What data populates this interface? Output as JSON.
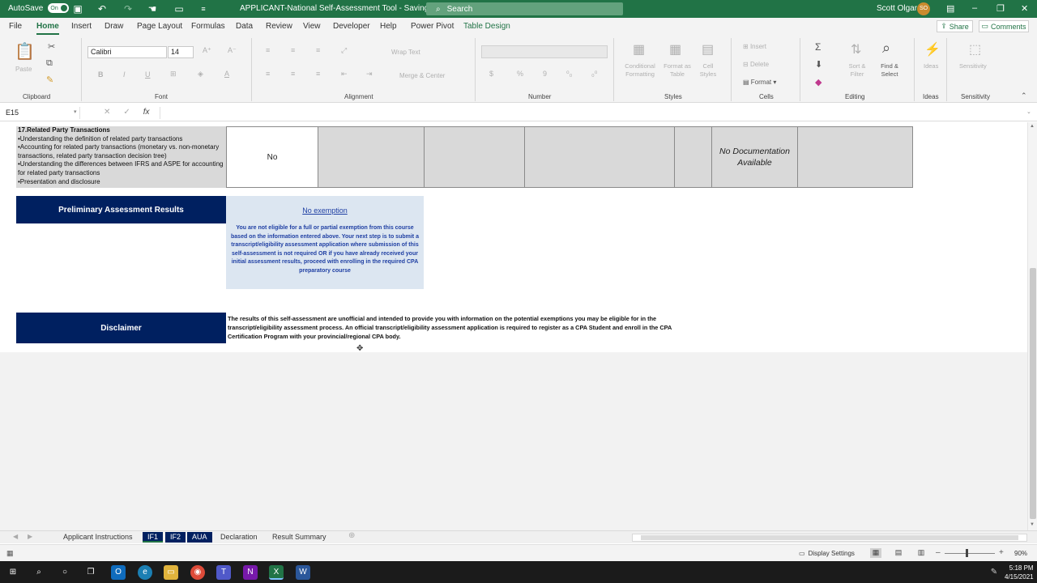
{
  "titlebar": {
    "autosave_label": "AutoSave",
    "autosave_state": "On",
    "doc_title": "APPLICANT-National Self-Assessment Tool  -  Saving...  ⌄",
    "search_placeholder": "Search",
    "user_name": "Scott Olgard",
    "user_initials": "SO"
  },
  "ribbon_tabs": [
    "File",
    "Home",
    "Insert",
    "Draw",
    "Page Layout",
    "Formulas",
    "Data",
    "Review",
    "View",
    "Developer",
    "Help",
    "Power Pivot",
    "Table Design"
  ],
  "ribbon_right": {
    "share": "Share",
    "comments": "Comments"
  },
  "ribbon": {
    "clipboard": {
      "paste": "Paste",
      "label": "Clipboard"
    },
    "font": {
      "family": "Calibri",
      "size": "14",
      "bold": "B",
      "italic": "I",
      "underline": "U",
      "label": "Font"
    },
    "alignment": {
      "wrap": "Wrap Text",
      "merge": "Merge & Center",
      "label": "Alignment"
    },
    "number": {
      "currency": "$",
      "percent": "%",
      "comma": "9",
      "label": "Number"
    },
    "styles": {
      "cond": "Conditional Formatting",
      "table": "Format as Table",
      "cell": "Cell Styles",
      "label": "Styles"
    },
    "cells": {
      "insert": "Insert",
      "delete": "Delete",
      "format": "Format",
      "label": "Cells"
    },
    "editing": {
      "sort": "Sort & Filter",
      "find": "Find & Select",
      "label": "Editing"
    },
    "ideas": {
      "btn": "Ideas",
      "label": "Ideas"
    },
    "sensitivity": {
      "btn": "Sensitivity",
      "label": "Sensitivity"
    }
  },
  "formula_bar": {
    "name_box": "E15",
    "fx": "fx",
    "content": ""
  },
  "sheet": {
    "row17": {
      "title": "17.Related Party Transactions",
      "bullets": [
        "•Understanding the definition of related party transactions",
        "•Accounting for related party transactions (monetary vs. non-monetary transactions, related party transaction decision tree)",
        "•Understanding the differences between IFRS and ASPE for accounting for related party transactions",
        "•Presentation and disclosure"
      ],
      "answer": "No",
      "documentation": "No Documentation Available"
    },
    "preliminary": {
      "heading": "Preliminary Assessment Results",
      "result_title": "No exemption",
      "result_text": "You are not eligible for a full or partial exemption from this course based on the information entered above. Your next step is to submit a transcript/eligibility assessment application where submission of this self-assessment is not required OR if you have already received your initial assessment results, proceed with enrolling in the required CPA preparatory course"
    },
    "disclaimer": {
      "heading": "Disclaimer",
      "text": "The results of this self-assessment are unofficial and intended to provide you with information on the potential exemptions you may be eligible for in the transcript/eligibility assessment process. An official transcript/eligibility assessment application is required to register as a CPA Student and enroll in the CPA Certification Program with your provincial/regional CPA body."
    }
  },
  "sheet_tabs": {
    "applicant": "Applicant Instructions",
    "if1": "IF1",
    "if2": "IF2",
    "aua": "AUA",
    "declaration": "Declaration",
    "summary": "Result Summary"
  },
  "statusbar": {
    "display_settings": "Display Settings",
    "zoom": "90%"
  },
  "taskbar": {
    "time": "5:18 PM",
    "date": "4/15/2021"
  },
  "colors": {
    "excel_green": "#217346",
    "navy": "#002060",
    "result_bg": "#dce6f1",
    "grey_cell": "#d9d9d9"
  }
}
